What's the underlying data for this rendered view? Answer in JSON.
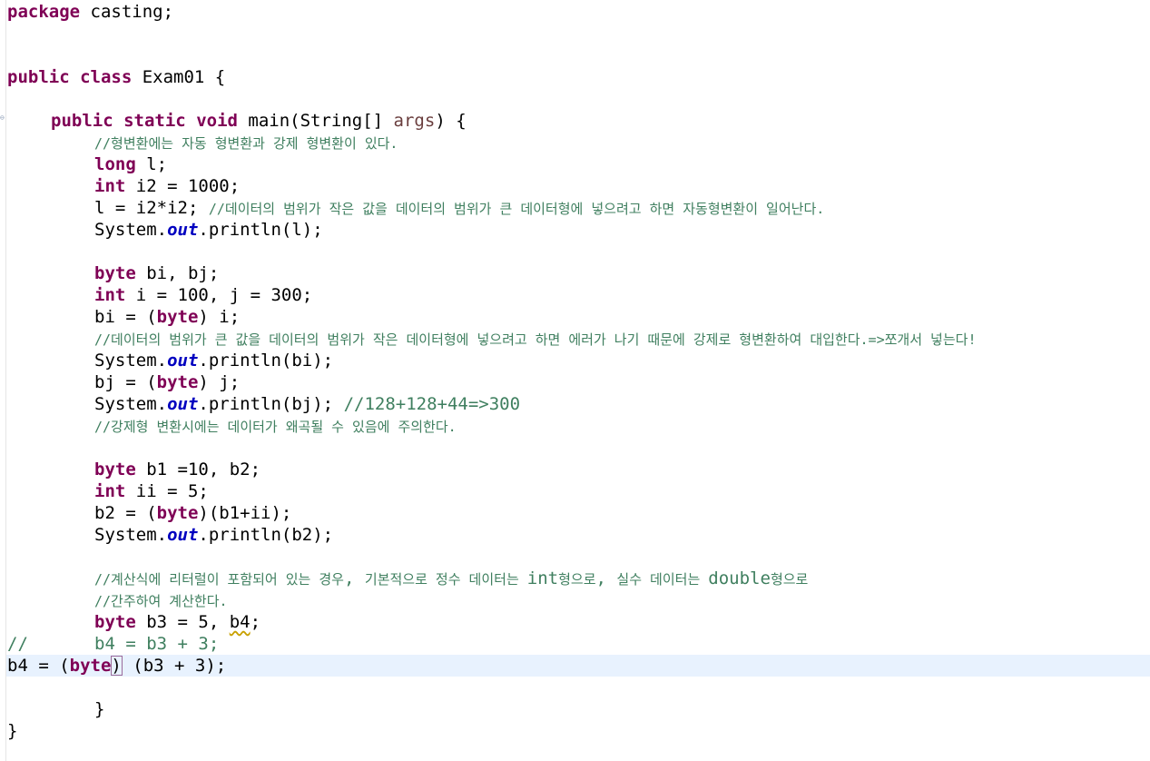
{
  "editor": {
    "lines": {
      "l1": {
        "kw": "package",
        "rest": " casting;"
      },
      "l2": {
        "kw1": "public",
        "kw2": "class",
        "rest": " Exam01 {"
      },
      "l3": {
        "kw1": "public",
        "kw2": "static",
        "kw3": "void",
        "mid": " main(String[] ",
        "param": "args",
        "end": ") {"
      },
      "l4": {
        "comment": "//형변환에는 자동 형변환과 강제 형변환이 있다."
      },
      "l5": {
        "kw": "long",
        "rest": " l;"
      },
      "l6": {
        "kw": "int",
        "rest": " i2 = 1000;"
      },
      "l7": {
        "code": "l = i2*i2; ",
        "comment": "//데이터의 범위가 작은 값을 데이터의 범위가 큰 데이터형에 넣으려고 하면 자동형변환이 일어난다."
      },
      "l8": {
        "pre": "System.",
        "static": "out",
        "post": ".println(l);"
      },
      "l9": {
        "kw": "byte",
        "rest": " bi, bj;"
      },
      "l10": {
        "kw": "int",
        "rest": " i = 100, j = 300;"
      },
      "l11": {
        "pre": "bi = (",
        "kw": "byte",
        "post": ") i;"
      },
      "l12": {
        "comment": "//데이터의 범위가 큰 값을 데이터의 범위가 작은 데이터형에 넣으려고 하면 에러가 나기 때문에 강제로 형변환하여 대입한다.=>쪼개서 넣는다!"
      },
      "l13": {
        "pre": "System.",
        "static": "out",
        "post": ".println(bi);"
      },
      "l14": {
        "pre": "bj = (",
        "kw": "byte",
        "post": ") j;"
      },
      "l15": {
        "pre": "System.",
        "static": "out",
        "post": ".println(bj); ",
        "comment": "//128+128+44=>300"
      },
      "l16": {
        "comment": "//강제형 변환시에는 데이터가 왜곡될 수 있음에 주의한다."
      },
      "l17": {
        "kw": "byte",
        "rest": " b1 =10, b2;"
      },
      "l18": {
        "kw": "int",
        "rest": " ii = 5;"
      },
      "l19": {
        "pre": "b2 = (",
        "kw": "byte",
        "post": ")(b1+ii);"
      },
      "l20": {
        "pre": "System.",
        "static": "out",
        "post": ".println(b2);"
      },
      "l21": {
        "c1": "//계산식에 리터럴이 포함되어 있는 경우",
        "c2": ", ",
        "c3": "기본적으로 정수 데이터는 ",
        "c4": "int",
        "c5": "형으로",
        "c6": ", ",
        "c7": "실수 데이터는 ",
        "c8": "double",
        "c9": "형으로"
      },
      "l22": {
        "comment": "//간주하여 계산한다."
      },
      "l23": {
        "kw": "byte",
        "mid": " b3 = 5, ",
        "warn": "b4",
        "end": ";"
      },
      "l24": {
        "slashes": "//",
        "code": "b4 = b3 + 3;"
      },
      "l25": {
        "pre": "b4 = (",
        "kw": "byte",
        "bracket": ")",
        "post": " (b3 + 3);"
      },
      "l26": {
        "brace": "}"
      },
      "l27": {
        "brace": "}"
      }
    }
  }
}
